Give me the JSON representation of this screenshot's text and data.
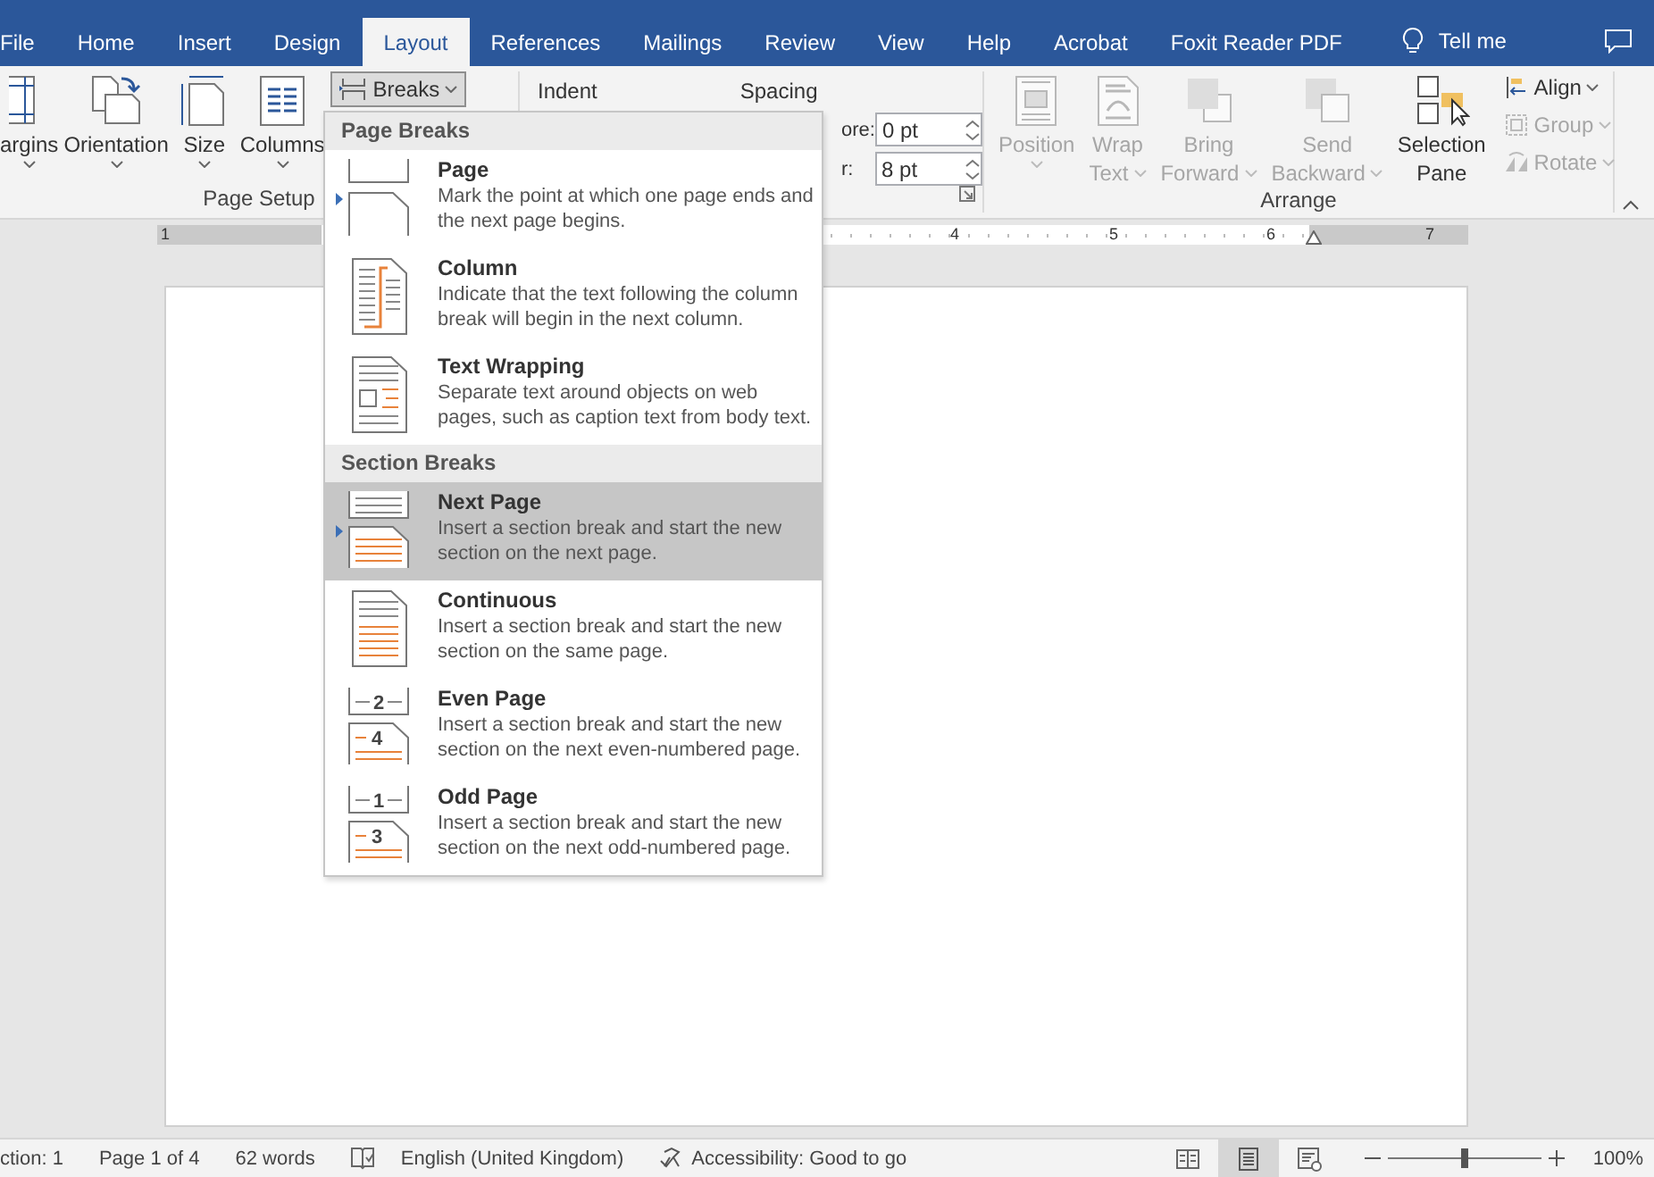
{
  "tabs": [
    {
      "label": "File",
      "selected": false
    },
    {
      "label": "Home",
      "selected": false
    },
    {
      "label": "Insert",
      "selected": false
    },
    {
      "label": "Design",
      "selected": false
    },
    {
      "label": "Layout",
      "selected": true
    },
    {
      "label": "References",
      "selected": false
    },
    {
      "label": "Mailings",
      "selected": false
    },
    {
      "label": "Review",
      "selected": false
    },
    {
      "label": "View",
      "selected": false
    },
    {
      "label": "Help",
      "selected": false
    },
    {
      "label": "Acrobat",
      "selected": false
    },
    {
      "label": "Foxit Reader PDF",
      "selected": false
    }
  ],
  "tell_me": "Tell me",
  "page_setup": {
    "buttons": [
      {
        "kind": "margins",
        "label": "argins"
      },
      {
        "kind": "orientation",
        "label": "Orientation"
      },
      {
        "kind": "size",
        "label": "Size"
      },
      {
        "kind": "columns",
        "label": "Columns"
      }
    ],
    "breaks": "Breaks",
    "label": "Page Setup"
  },
  "paragraph": {
    "indent": "Indent",
    "spacing": "Spacing",
    "fields": [
      {
        "label": "ore:",
        "value": "0 pt"
      },
      {
        "label": "r:",
        "value": "8 pt"
      }
    ]
  },
  "arrange": {
    "buttons": [
      {
        "kind": "position",
        "line1": "Position",
        "disabled": true
      },
      {
        "kind": "wrap",
        "line1": "Wrap",
        "line2": "Text",
        "disabled": true
      },
      {
        "kind": "forward",
        "line1": "Bring",
        "line2": "Forward",
        "disabled": true
      },
      {
        "kind": "backward",
        "line1": "Send",
        "line2": "Backward",
        "disabled": true
      },
      {
        "kind": "selection",
        "line1": "Selection",
        "line2": "Pane",
        "disabled": false
      }
    ],
    "small": [
      {
        "kind": "align",
        "label": "Align",
        "disabled": false
      },
      {
        "kind": "group",
        "label": "Group",
        "disabled": true
      },
      {
        "kind": "rotate",
        "label": "Rotate",
        "disabled": true
      }
    ],
    "label": "Arrange"
  },
  "ruler": {
    "numbers": [
      "1",
      "4",
      "5",
      "6",
      "7"
    ]
  },
  "breaks_menu": {
    "sections": [
      {
        "heading": "Page Breaks",
        "items": [
          {
            "kind": "page",
            "title": "Page",
            "description": "Mark the point at which one page ends and the next page begins.",
            "selected": false,
            "pointer": true
          },
          {
            "kind": "column",
            "title": "Column",
            "description": "Indicate that the text following the column break will begin in the next column.",
            "selected": false,
            "pointer": false
          },
          {
            "kind": "wrapping",
            "title": "Text Wrapping",
            "description": "Separate text around objects on web pages, such as caption text from body text.",
            "selected": false,
            "pointer": false
          }
        ]
      },
      {
        "heading": "Section Breaks",
        "items": [
          {
            "kind": "next",
            "title": "Next Page",
            "description": "Insert a section break and start the new section on the next page.",
            "selected": true,
            "pointer": true
          },
          {
            "kind": "continuous",
            "title": "Continuous",
            "description": "Insert a section break and start the new section on the same page.",
            "selected": false,
            "pointer": false
          },
          {
            "kind": "numbered",
            "title": "Even Page",
            "description": "Insert a section break and start the new section on the next even-numbered page.",
            "selected": false,
            "pointer": false,
            "icon_numbers": [
              "2",
              "4"
            ]
          },
          {
            "kind": "numbered",
            "title": "Odd Page",
            "description": "Insert a section break and start the new section on the next odd-numbered page.",
            "selected": false,
            "pointer": false,
            "icon_numbers": [
              "1",
              "3"
            ]
          }
        ]
      }
    ]
  },
  "status_bar": {
    "section": "ction: 1",
    "page": "Page 1 of 4",
    "words": "62 words",
    "language": "English (United Kingdom)",
    "accessibility": "Accessibility: Good to go",
    "views": [
      {
        "kind": "read",
        "selected": false
      },
      {
        "kind": "print",
        "selected": true
      },
      {
        "kind": "web",
        "selected": false
      }
    ],
    "zoom": {
      "level": 0.5,
      "reading": "100%"
    }
  }
}
